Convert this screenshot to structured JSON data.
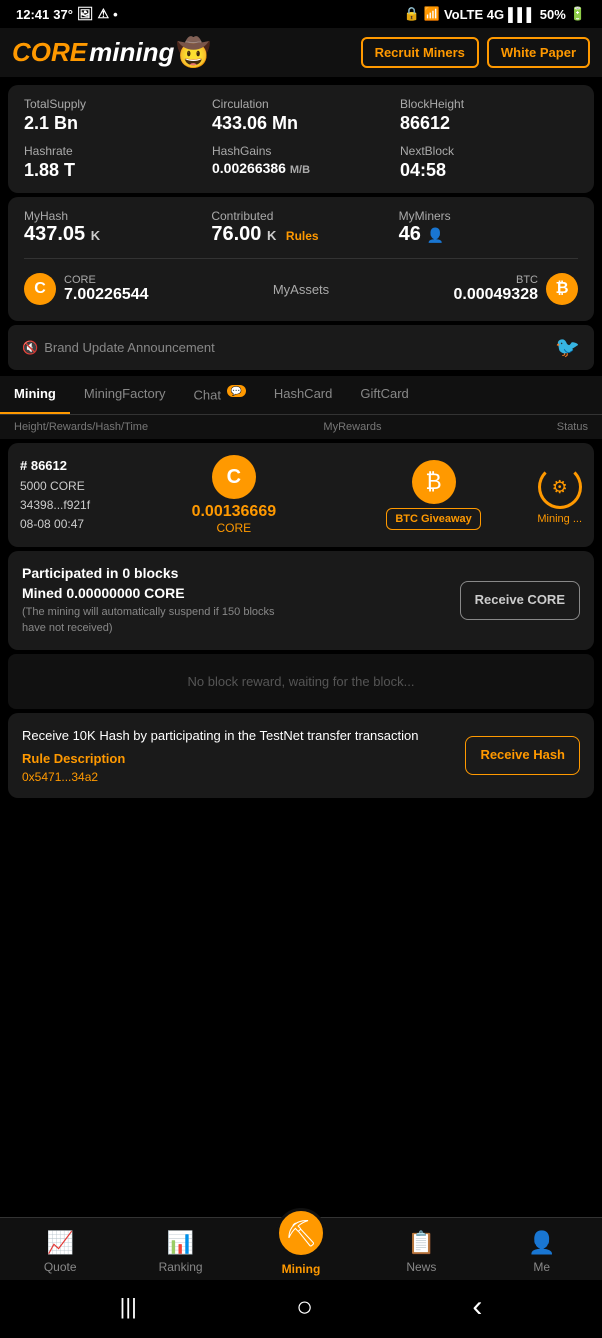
{
  "statusBar": {
    "time": "12:41",
    "temp": "37°",
    "battery": "50%"
  },
  "header": {
    "logoCore": "CORE",
    "logoMining": "mining",
    "recruitBtn": "Recruit\nMiners",
    "whitePaperBtn": "White\nPaper"
  },
  "stats": {
    "totalSupplyLabel": "TotalSupply",
    "totalSupplyValue": "2.1 Bn",
    "circulationLabel": "Circulation",
    "circulationValue": "433.06 Mn",
    "blockHeightLabel": "BlockHeight",
    "blockHeightValue": "86612",
    "hashrateLabel": "Hashrate",
    "hashrateValue": "1.88 T",
    "hashGainsLabel": "HashGains",
    "hashGainsValue": "0.00266386",
    "hashGainsUnit": "M/B",
    "nextBlockLabel": "NextBlock",
    "nextBlockValue": "04:58"
  },
  "myStats": {
    "myHashLabel": "MyHash",
    "myHashValue": "437.05",
    "myHashUnit": "K",
    "contributedLabel": "Contributed",
    "contributedValue": "76.00",
    "contributedUnit": "K",
    "rulesLink": "Rules",
    "myMinersLabel": "MyMiners",
    "myMinersValue": "46"
  },
  "assets": {
    "label": "MyAssets",
    "coreName": "CORE",
    "coreValue": "7.00226544",
    "btcName": "BTC",
    "btcValue": "0.00049328"
  },
  "announcement": {
    "text": "Brand Update Announcement"
  },
  "tabs": [
    {
      "id": "mining",
      "label": "Mining",
      "active": true
    },
    {
      "id": "miningfactory",
      "label": "MiningFactory",
      "active": false
    },
    {
      "id": "chat",
      "label": "Chat",
      "active": false,
      "badge": "💬"
    },
    {
      "id": "hashcard",
      "label": "HashCard",
      "active": false
    },
    {
      "id": "giftcard",
      "label": "GiftCard",
      "active": false
    }
  ],
  "tableHeader": {
    "left": "Height/Rewards/Hash/Time",
    "center": "MyRewards",
    "right": "Status"
  },
  "miningRow": {
    "blockNum": "# 86612",
    "rewards": "5000 CORE",
    "hash": "34398...f921f",
    "time": "08-08 00:47",
    "coreAmount": "0.00136669",
    "coreLabel": "CORE",
    "btcGiveaway": "BTC Giveaway",
    "statusLabel": "Mining ..."
  },
  "participation": {
    "title": "Participated in 0 blocks",
    "mined": "Mined 0.00000000 CORE",
    "note": "(The mining will automatically suspend if 150 blocks have not received)",
    "receiveBtn": "Receive\nCORE"
  },
  "noReward": {
    "message": "No block reward, waiting for the block..."
  },
  "receiveHash": {
    "title": "Receive 10K Hash by participating in the TestNet transfer transaction",
    "ruleLabel": "Rule Description",
    "address": "0x5471...34a2",
    "btnLabel": "Receive\nHash"
  },
  "bottomNav": [
    {
      "id": "quote",
      "label": "Quote",
      "icon": "📈",
      "active": false
    },
    {
      "id": "ranking",
      "label": "Ranking",
      "icon": "📊",
      "active": false
    },
    {
      "id": "mining",
      "label": "Mining",
      "icon": "⛏",
      "active": true,
      "special": true
    },
    {
      "id": "news",
      "label": "News",
      "icon": "📋",
      "active": false
    },
    {
      "id": "me",
      "label": "Me",
      "icon": "👤",
      "active": false
    }
  ],
  "phoneControls": {
    "menu": "|||",
    "home": "○",
    "back": "‹"
  }
}
